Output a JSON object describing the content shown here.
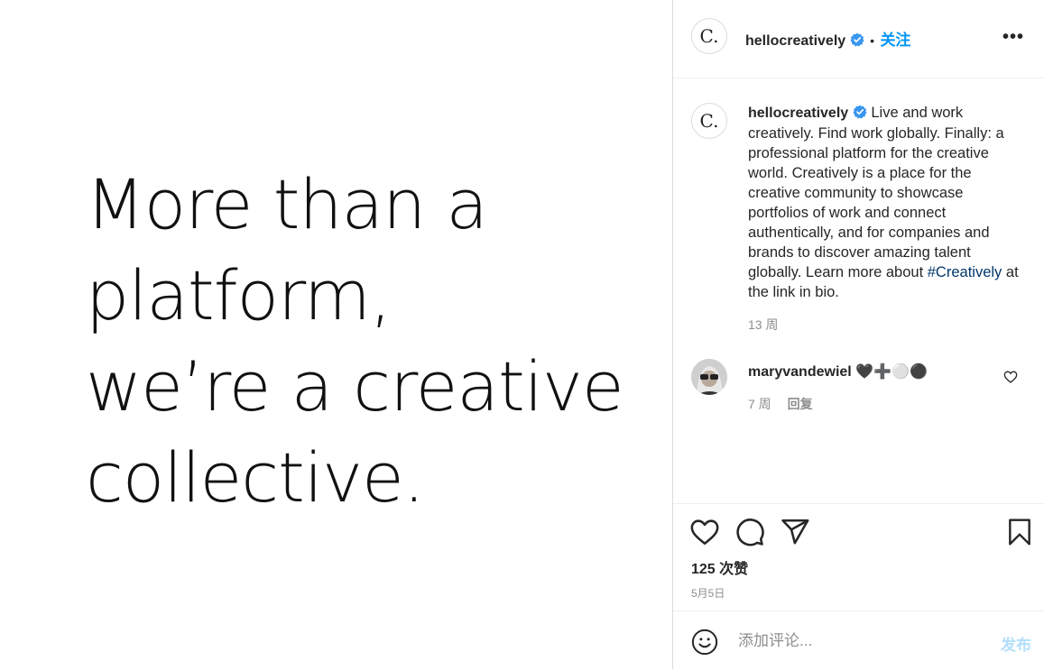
{
  "media": {
    "lines": [
      "More than a",
      "platform,",
      "we’re a creative",
      "collective."
    ]
  },
  "header": {
    "avatar_letter": "C.",
    "username": "hellocreatively",
    "dot": "•",
    "follow_label": "关注",
    "more_label": "•••"
  },
  "caption": {
    "avatar_letter": "C.",
    "username": "hellocreatively",
    "text": "Live and work creatively. Find work globally. Finally: a professional platform for the creative world. Creatively is a place for the creative community to showcase portfolios of work and connect authentically, and for companies and brands to discover amazing talent globally. Learn more about",
    "hashtag": "#Creatively",
    "text_end": "at the link in bio.",
    "time": "13 周"
  },
  "comment": {
    "username": "maryvandewiel",
    "text": "🖤➕⚪⚫",
    "time": "7 周",
    "reply_label": "回复"
  },
  "actions": {
    "likes": "125 次赞",
    "date": "5月5日"
  },
  "add_comment": {
    "placeholder": "添加评论...",
    "post_label": "发布"
  },
  "colors": {
    "accent": "#0095f6",
    "verified": "#3897f0",
    "hashtag": "#00376b",
    "muted": "#8e8e8e"
  }
}
